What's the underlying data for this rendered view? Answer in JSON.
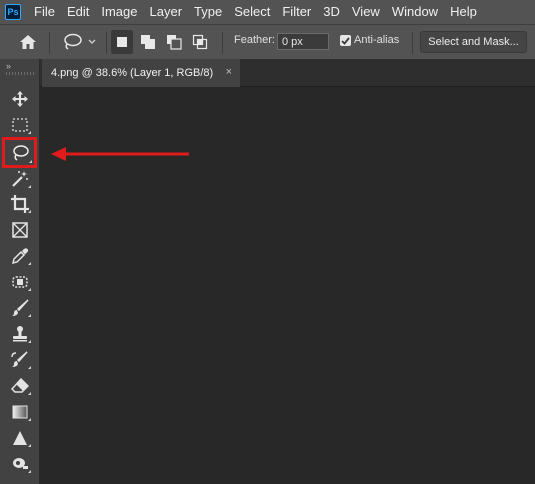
{
  "app": {
    "logo_text": "Ps"
  },
  "menu": [
    "File",
    "Edit",
    "Image",
    "Layer",
    "Type",
    "Select",
    "Filter",
    "3D",
    "View",
    "Window",
    "Help"
  ],
  "options": {
    "feather_label": "Feather:",
    "feather_value": "0 px",
    "antialias_label": "Anti-alias",
    "antialias_checked": true,
    "select_mask_label": "Select and Mask..."
  },
  "document": {
    "tab_title": "4.png @ 38.6% (Layer 1, RGB/8)",
    "close_glyph": "×"
  },
  "toolbar": {
    "collapse_glyph": "»",
    "tools": [
      {
        "name": "move-tool",
        "icon": "move-icon"
      },
      {
        "name": "rectangular-marquee-tool",
        "icon": "marquee-icon"
      },
      {
        "name": "lasso-tool",
        "icon": "lasso-icon",
        "highlighted": true
      },
      {
        "name": "magic-wand-tool",
        "icon": "magic-wand-icon"
      },
      {
        "name": "crop-tool",
        "icon": "crop-icon"
      },
      {
        "name": "frame-tool",
        "icon": "frame-icon"
      },
      {
        "name": "eyedropper-tool",
        "icon": "eyedropper-icon"
      },
      {
        "name": "spot-healing-tool",
        "icon": "bandage-icon"
      },
      {
        "name": "brush-tool",
        "icon": "brush-icon"
      },
      {
        "name": "clone-stamp-tool",
        "icon": "stamp-icon"
      },
      {
        "name": "history-brush-tool",
        "icon": "history-brush-icon"
      },
      {
        "name": "eraser-tool",
        "icon": "eraser-icon"
      },
      {
        "name": "gradient-tool",
        "icon": "gradient-icon"
      },
      {
        "name": "sharpen-tool",
        "icon": "sharpen-icon"
      },
      {
        "name": "dodge-tool",
        "icon": "dodge-icon"
      }
    ]
  },
  "annotation": {
    "arrow_color": "#e01b1b",
    "highlight_color": "#e01b1b"
  }
}
